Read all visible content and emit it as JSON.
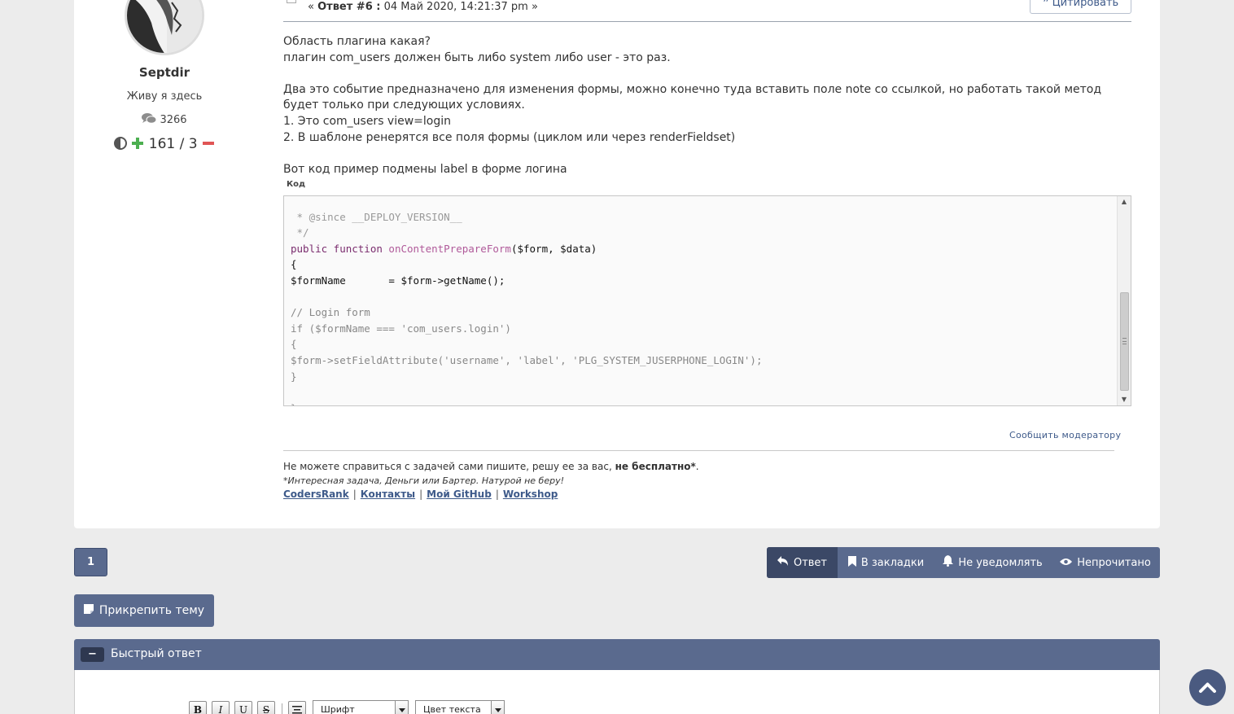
{
  "poster": {
    "name": "Septdir",
    "title": "Живу я здесь",
    "post_count": "3266",
    "karma": "161 / 3"
  },
  "post": {
    "meta_prefix": "«",
    "meta_label": "Ответ #6 :",
    "meta_date": "04 Май 2020, 14:21:37 pm »",
    "quote_label": "Цитировать",
    "paragraphs": [
      "Область плагина какая?",
      "плагин com_users должен быть либо system либо user - это раз.",
      "",
      "Два это событие предназначено для изменения формы, можно конечно туда вставить поле note со ссылкой, но работать такой метод будет только при следующих условиях.",
      "1. Это com_users view=login",
      "2. В шаблоне ренерятся все поля формы (циклом или через renderFieldset)",
      "",
      "Вот код пример подмены label в форме логина"
    ],
    "code_label": "Код",
    "code": {
      "l1": " * @since __DEPLOY_VERSION__",
      "l2": " */",
      "l3_kw": "public function",
      "l3_fn": "onContentPrepareForm",
      "l3_rest": "($form, $data)",
      "l4": "{",
      "l5": "$formName       = $form->getName();",
      "l6": "",
      "l7": "// Login form",
      "l8": "if ($formName === 'com_users.login')",
      "l9": "{",
      "l10": "$form->setFieldAttribute('username', 'label', 'PLG_SYSTEM_JUSERPHONE_LOGIN');",
      "l11": "}",
      "l12": "",
      "l13": "}"
    },
    "report_label": "Сообщить модератору"
  },
  "signature": {
    "line1_text": "Не можете справиться с задачей сами пишите, решу ее за вас, ",
    "line1_bold": "не бесплатно*",
    "line1_end": ".",
    "line2": "*Интересная задача, Деньги или Бартер. Натурой не беру!",
    "links": [
      "CodersRank",
      "Контакты",
      "Мой GitHub",
      "Workshop"
    ],
    "separator": "|"
  },
  "pagination": {
    "current_page": "1"
  },
  "actions": {
    "reply": "Ответ",
    "bookmark": "В закладки",
    "notify": "Не уведомлять",
    "unread": "Непрочитано"
  },
  "pin_label": "Прикрепить тему",
  "quick_reply": {
    "collapse_symbol": "−",
    "title": "Быстрый ответ"
  },
  "editor": {
    "bold": "B",
    "italic": "I",
    "underline": "U",
    "strike": "S",
    "font_select": "Шрифт",
    "color_select": "Цвет текста"
  },
  "colors": {
    "accent": "#5a6a8e",
    "accent_dark": "#3b4866",
    "link": "#3e5a8a",
    "karma_plus": "#4caf50",
    "karma_minus": "#e05555"
  },
  "icons": {
    "posts": "comments-icon",
    "karma": "half-circle-icon",
    "karma_plus": "plus-icon",
    "karma_minus": "minus-icon",
    "quote": "quote-icon",
    "reply": "reply-arrow-icon",
    "bookmark": "bookmark-icon",
    "notify": "bell-icon",
    "unread": "eye-icon",
    "pin": "sticky-note-icon",
    "scroll_top": "chevron-up-icon"
  }
}
